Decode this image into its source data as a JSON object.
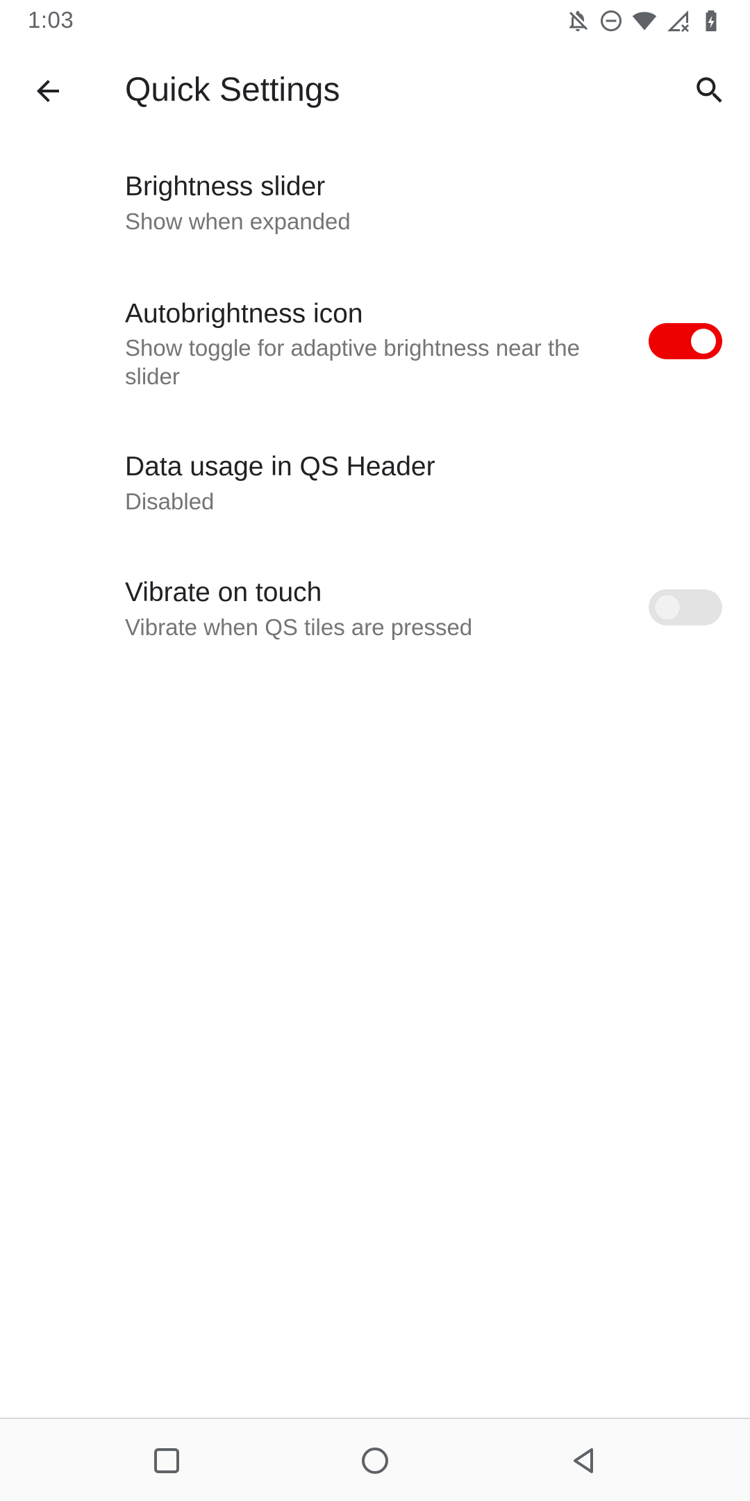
{
  "status_bar": {
    "time": "1:03",
    "icons": [
      "notifications-off-icon",
      "do-not-disturb-icon",
      "wifi-icon",
      "cell-signal-icon",
      "battery-charging-icon"
    ]
  },
  "toolbar": {
    "title": "Quick Settings",
    "back_icon": "back-arrow-icon",
    "search_icon": "search-icon"
  },
  "preferences": [
    {
      "title": "Brightness slider",
      "summary": "Show when expanded"
    },
    {
      "title": "Autobrightness icon",
      "summary": "Show toggle for adaptive brightness near the slider",
      "switch": true
    },
    {
      "title": "Data usage in QS Header",
      "summary": "Disabled"
    },
    {
      "title": "Vibrate on touch",
      "summary": "Vibrate when QS tiles are pressed",
      "switch": false
    }
  ],
  "nav_bar": {
    "icons": [
      "recents-icon",
      "home-icon",
      "back-icon"
    ]
  },
  "colors": {
    "accent": "#ee0000",
    "title_text": "#202124",
    "summary_text": "#757575",
    "switch_off_track": "#e3e3e3"
  }
}
